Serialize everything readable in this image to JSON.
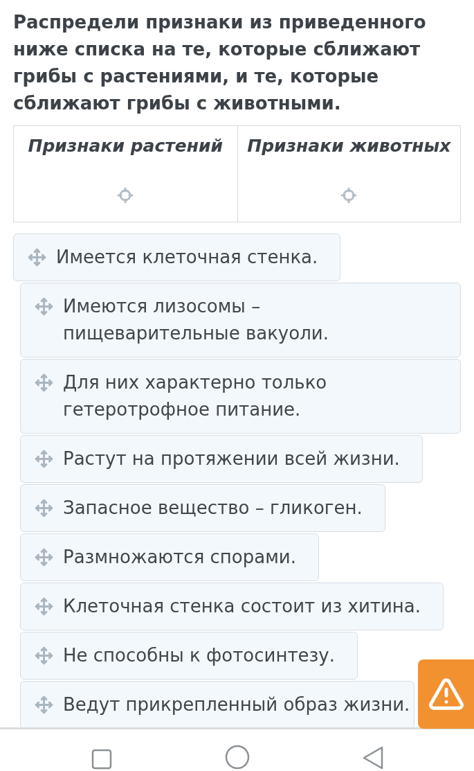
{
  "question": "Распредели признаки из приведенного ниже списка на те, которые сближают грибы с растениями, и те, которые сближают грибы с животными.",
  "columns": [
    {
      "heading": "Признаки растений"
    },
    {
      "heading": "Признаки животных"
    }
  ],
  "items": [
    {
      "text": "Имеется клеточная стенка."
    },
    {
      "text": "Имеются лизосомы – пищеварительные вакуоли."
    },
    {
      "text": "Для них характерно только гетеротрофное питание."
    },
    {
      "text": "Растут на протяжении всей жизни."
    },
    {
      "text": "Запасное вещество – гликоген."
    },
    {
      "text": "Размножаются спорами."
    },
    {
      "text": "Клеточная стенка состоит из хитина."
    },
    {
      "text": "Не способны к фотосинтезу."
    },
    {
      "text": "Ведут прикрепленный образ жизни."
    }
  ]
}
